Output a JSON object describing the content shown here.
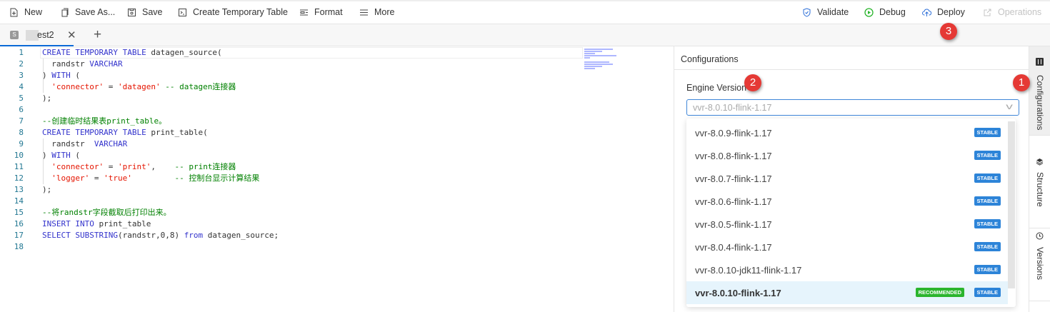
{
  "toolbar": {
    "new": "New",
    "save_as": "Save As...",
    "save": "Save",
    "create_temp": "Create Temporary Table",
    "format": "Format",
    "more": "More",
    "validate": "Validate",
    "debug": "Debug",
    "deploy": "Deploy",
    "operations": "Operations"
  },
  "tabs": {
    "badge": "S",
    "name": "est2"
  },
  "editor": {
    "lines": [
      [
        [
          "k2",
          "CREATE TEMPORARY TABLE"
        ],
        [
          "p",
          " datagen_source("
        ]
      ],
      [
        [
          "p",
          "  randstr "
        ],
        [
          "k2",
          "VARCHAR"
        ]
      ],
      [
        [
          "p",
          ") "
        ],
        [
          "k2",
          "WITH"
        ],
        [
          "p",
          " ("
        ]
      ],
      [
        [
          "s1",
          "  'connector'"
        ],
        [
          "p",
          " = "
        ],
        [
          "s1",
          "'datagen'"
        ],
        [
          "c",
          " -- datagen连接器"
        ]
      ],
      [
        [
          "p",
          ");"
        ]
      ],
      [],
      [
        [
          "c",
          "--创建临时结果表print_table。"
        ]
      ],
      [
        [
          "k2",
          "CREATE TEMPORARY TABLE"
        ],
        [
          "p",
          " print_table("
        ]
      ],
      [
        [
          "p",
          "  randstr  "
        ],
        [
          "k2",
          "VARCHAR"
        ]
      ],
      [
        [
          "p",
          ") "
        ],
        [
          "k2",
          "WITH"
        ],
        [
          "p",
          " ("
        ]
      ],
      [
        [
          "s1",
          "  'connector'"
        ],
        [
          "p",
          " = "
        ],
        [
          "s1",
          "'print'"
        ],
        [
          "p",
          ",    "
        ],
        [
          "c",
          "-- print连接器"
        ]
      ],
      [
        [
          "s1",
          "  'logger'"
        ],
        [
          "p",
          " = "
        ],
        [
          "s1",
          "'true'"
        ],
        [
          "p",
          "         "
        ],
        [
          "c",
          "-- 控制台显示计算结果"
        ]
      ],
      [
        [
          "p",
          ");"
        ]
      ],
      [],
      [
        [
          "c",
          "--将randstr字段截取后打印出来。"
        ]
      ],
      [
        [
          "k2",
          "INSERT INTO"
        ],
        [
          "p",
          " print_table"
        ]
      ],
      [
        [
          "k2",
          "SELECT SUBSTRING"
        ],
        [
          "p",
          "(randstr,0,8) "
        ],
        [
          "k2",
          "from"
        ],
        [
          "p",
          " datagen_source;"
        ]
      ],
      []
    ]
  },
  "panel": {
    "title": "Configurations",
    "engine_label": "Engine Version",
    "engine_value": "vvr-8.0.10-flink-1.17",
    "options": [
      {
        "label": "vvr-8.0.9-flink-1.17",
        "tags": [
          "STABLE"
        ]
      },
      {
        "label": "vvr-8.0.8-flink-1.17",
        "tags": [
          "STABLE"
        ]
      },
      {
        "label": "vvr-8.0.7-flink-1.17",
        "tags": [
          "STABLE"
        ]
      },
      {
        "label": "vvr-8.0.6-flink-1.17",
        "tags": [
          "STABLE"
        ]
      },
      {
        "label": "vvr-8.0.5-flink-1.17",
        "tags": [
          "STABLE"
        ]
      },
      {
        "label": "vvr-8.0.4-flink-1.17",
        "tags": [
          "STABLE"
        ]
      },
      {
        "label": "vvr-8.0.10-jdk11-flink-1.17",
        "tags": [
          "STABLE"
        ]
      },
      {
        "label": "vvr-8.0.10-flink-1.17",
        "tags": [
          "RECOMMENDED",
          "STABLE"
        ],
        "selected": true
      }
    ]
  },
  "side": {
    "configurations": "Configurations",
    "structure": "Structure",
    "versions": "Versions"
  },
  "callouts": {
    "one": "1",
    "two": "2",
    "three": "3"
  },
  "colors": {
    "accent": "#0b6ad6",
    "stable": "#2d84d8",
    "recommended": "#2bb52e",
    "callout": "#e53935"
  }
}
